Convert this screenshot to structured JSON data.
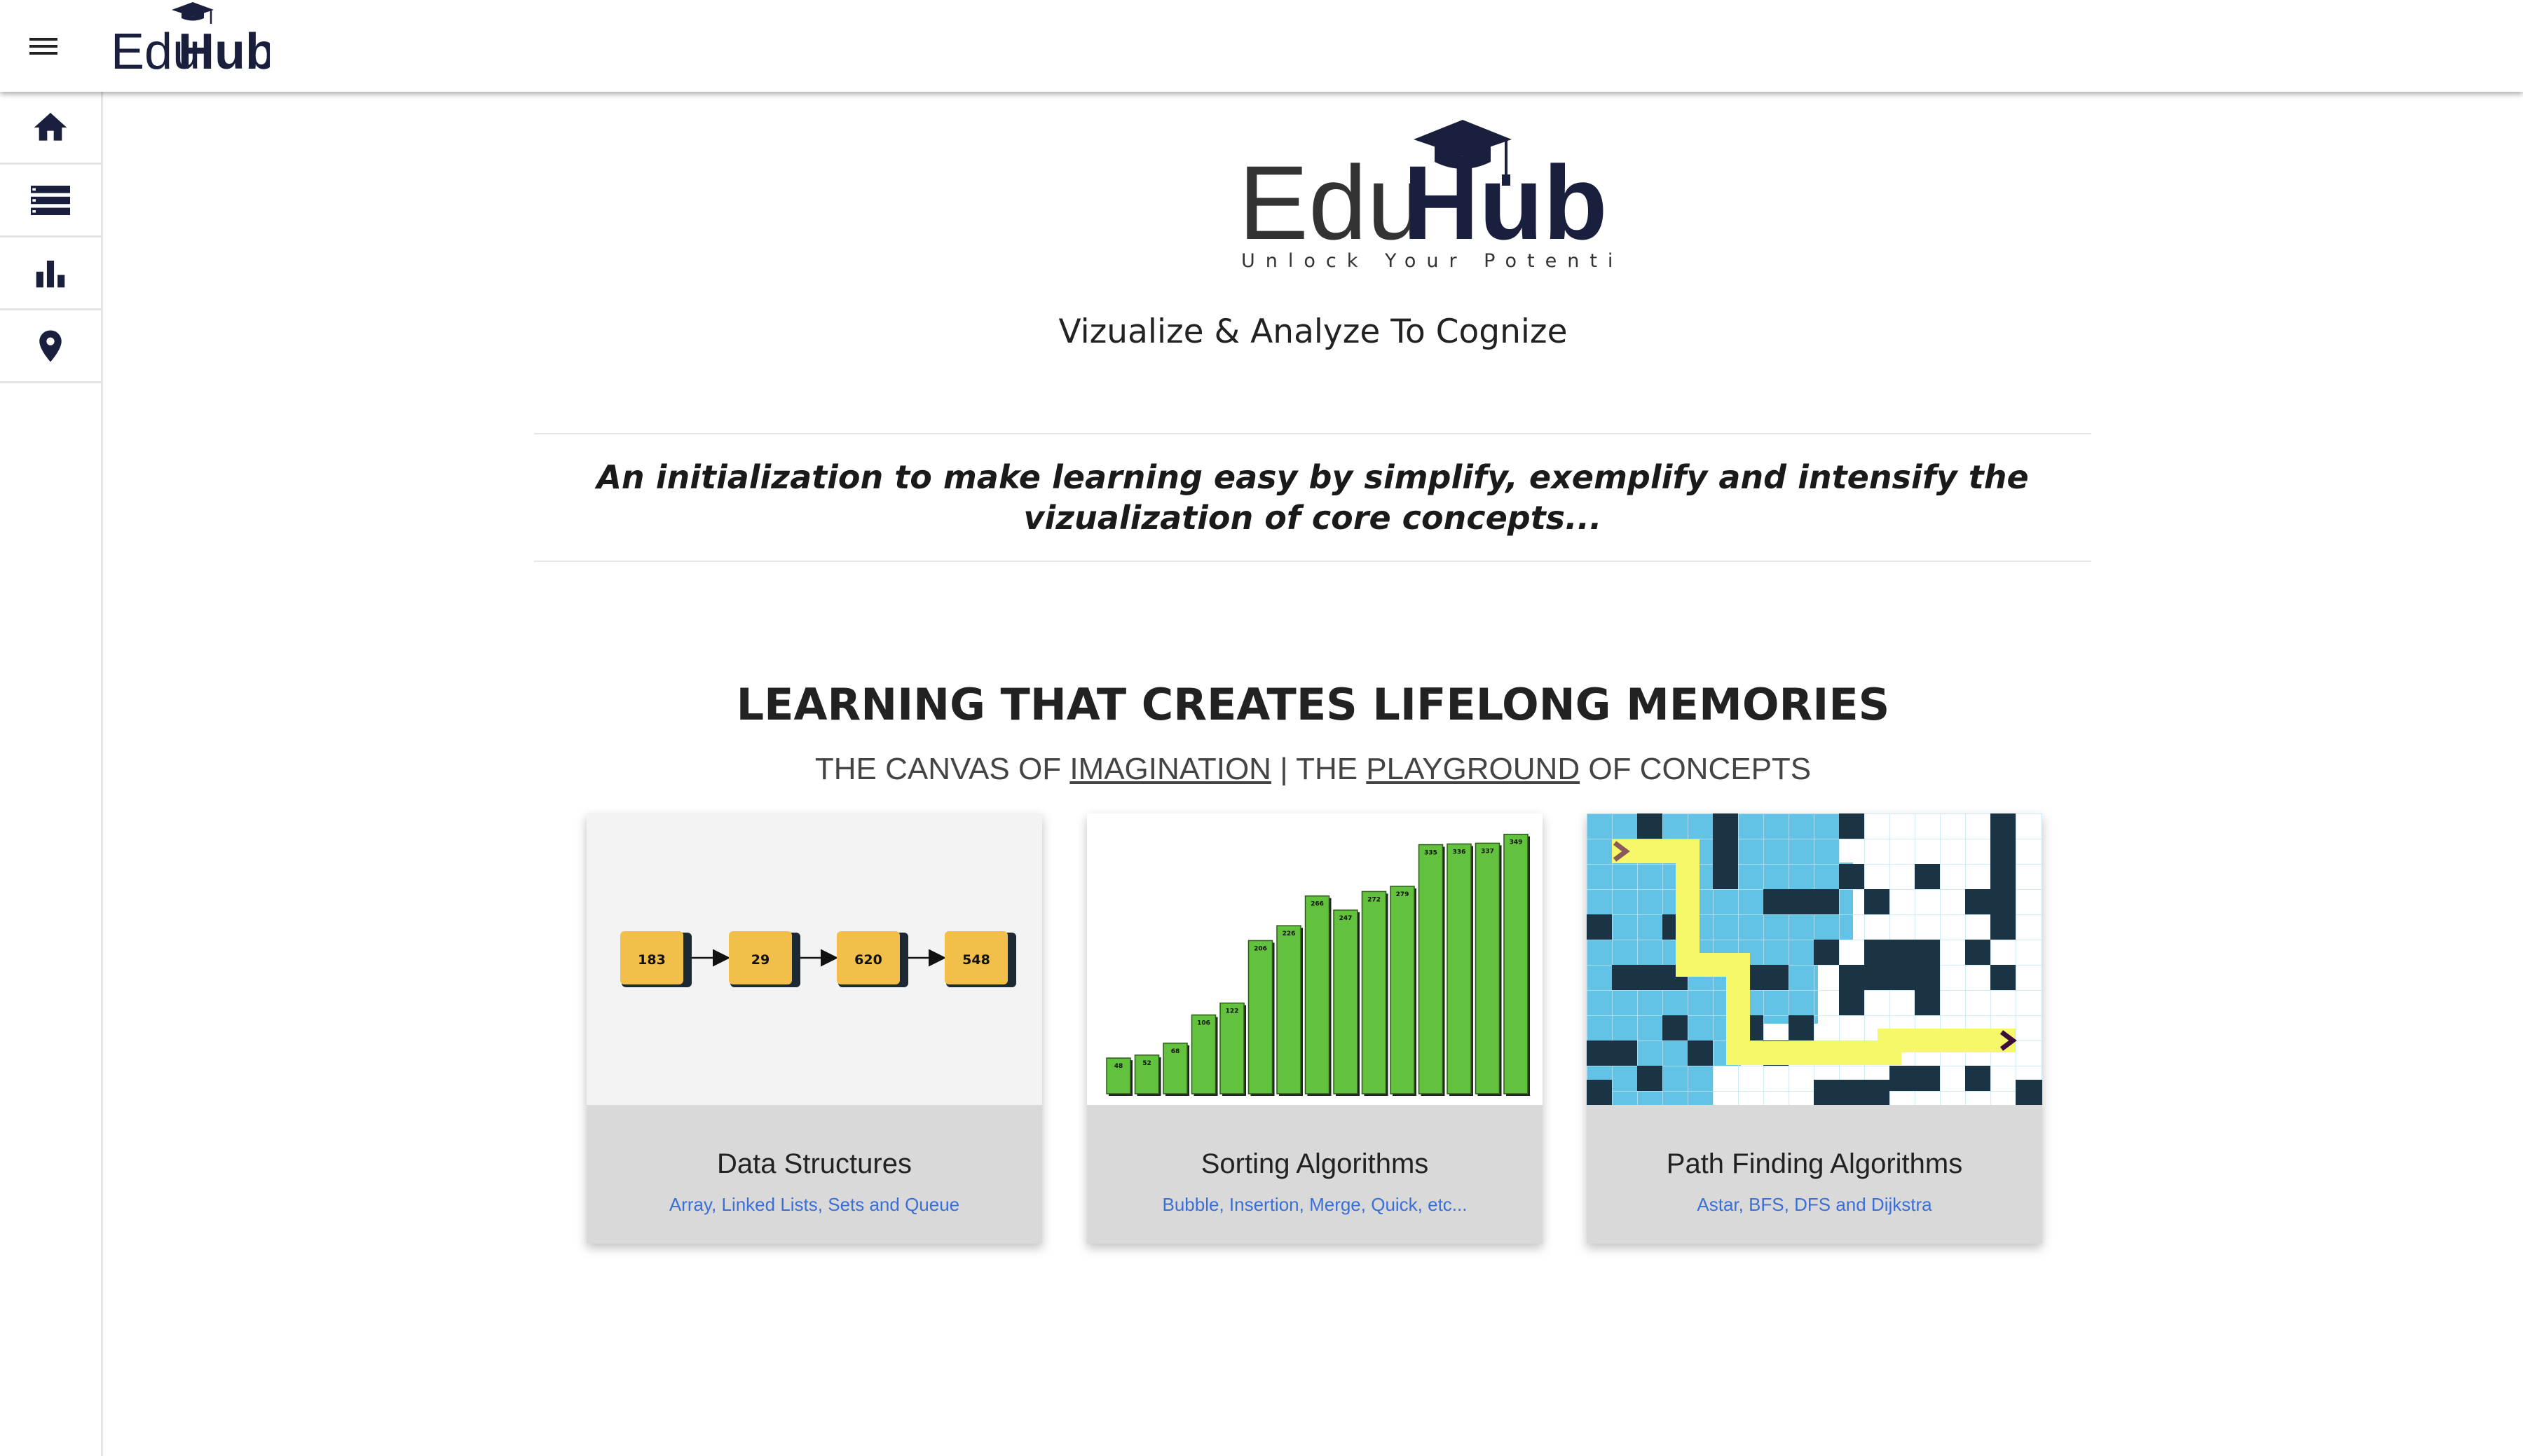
{
  "brand": {
    "name_part1": "Edu",
    "name_part2": "Hub",
    "tagline": "Unlock Your Potential"
  },
  "hero": {
    "subtitle": "Vizualize & Analyze To Cognize",
    "quote": "An initialization to make learning easy by simplify, exemplify and intensify the vizualization of core concepts..."
  },
  "section": {
    "title": "LEARNING THAT CREATES LIFELONG MEMORIES",
    "sub_pre": "THE CANVAS OF",
    "sub_link1": "IMAGINATION",
    "sub_mid": "| THE",
    "sub_link2": "PLAYGROUND",
    "sub_post": "OF CONCEPTS"
  },
  "sidebar": {
    "items": [
      {
        "icon": "home-icon"
      },
      {
        "icon": "list-icon"
      },
      {
        "icon": "bar-chart-icon"
      },
      {
        "icon": "location-pin-icon"
      }
    ]
  },
  "cards": [
    {
      "title": "Data Structures",
      "subtitle": "Array, Linked Lists, Sets and Queue",
      "nodes": [
        "183",
        "29",
        "620",
        "548"
      ]
    },
    {
      "title": "Sorting Algorithms",
      "subtitle": "Bubble, Insertion, Merge, Quick, etc...",
      "bars": [
        48,
        52,
        68,
        106,
        122,
        206,
        226,
        266,
        247,
        272,
        279,
        335,
        336,
        337,
        349
      ]
    },
    {
      "title": "Path Finding Algorithms",
      "subtitle": "Astar, BFS, DFS and Dijkstra"
    }
  ],
  "colors": {
    "brand_dark": "#1a1f3d",
    "node_yellow": "#f2c04a",
    "bar_green": "#62c13d",
    "grid_blue": "#62c3e6",
    "grid_wall": "#1a3446",
    "path_yellow": "#f7f76a",
    "link_blue": "#3a6fd8"
  }
}
